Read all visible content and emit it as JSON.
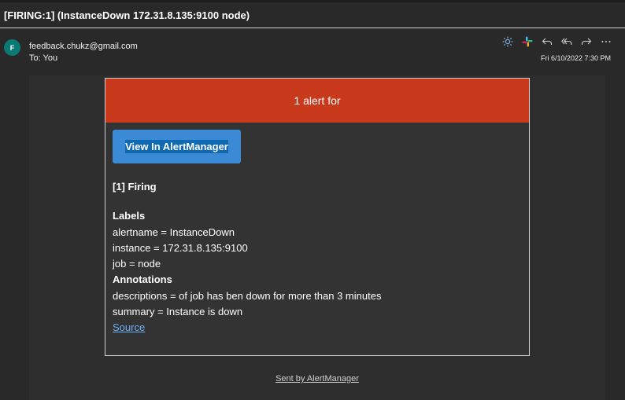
{
  "email": {
    "subject": "[FIRING:1] (InstanceDown 172.31.8.135:9100 node)",
    "avatar_initial": "F",
    "sender": "feedback.chukz@gmail.com",
    "recipient": "To: You",
    "date": "Fri 6/10/2022 7:30 PM"
  },
  "toolbar": {
    "icons": [
      "sun-icon",
      "slack-icon",
      "reply-icon",
      "reply-all-icon",
      "forward-icon",
      "more-icon"
    ]
  },
  "alert": {
    "header": "1 alert for",
    "header_color": "#c83a1b",
    "button_label": "View In AlertManager",
    "firing": "[1] Firing",
    "labels_heading": "Labels",
    "labels": [
      "alertname = InstanceDown",
      "instance = 172.31.8.135:9100",
      "job = node"
    ],
    "annotations_heading": "Annotations",
    "annotations": [
      "descriptions = of job has ben down for more than 3 minutes",
      "summary = Instance is down"
    ],
    "source_link": "Source"
  },
  "footer": {
    "text": "Sent by AlertManager"
  }
}
